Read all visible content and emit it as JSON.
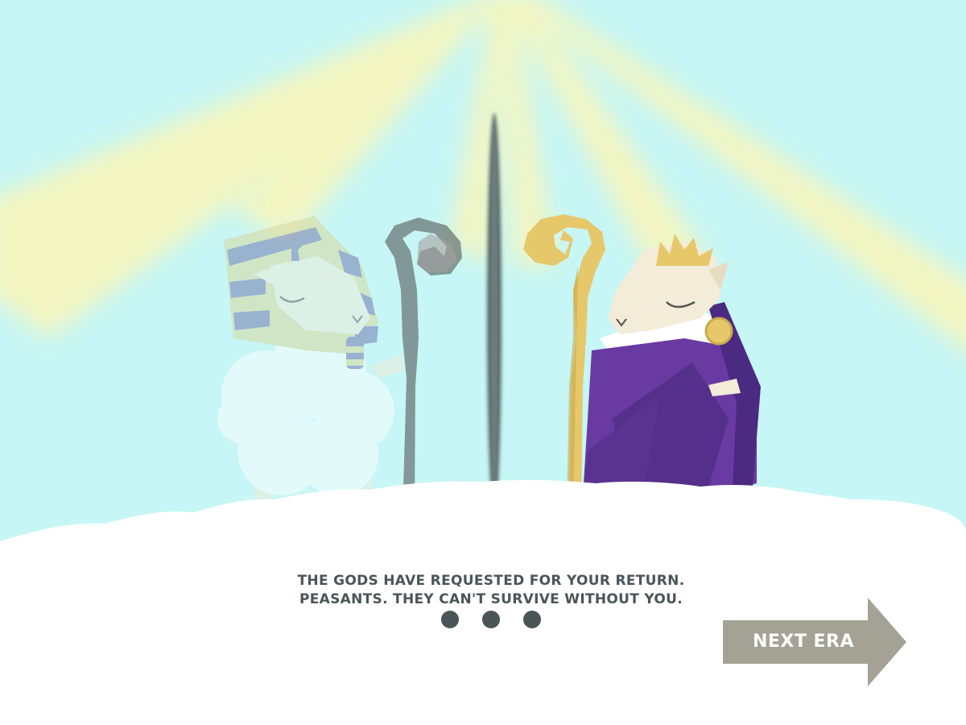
{
  "story": {
    "line1": "THE GODS HAVE REQUESTED FOR YOUR RETURN.",
    "line2": "PEASANTS. THEY CAN'T SURVIVE WITHOUT YOU."
  },
  "pagination": {
    "total": 3
  },
  "next_button": {
    "label": "NEXT ERA"
  },
  "scene": {
    "left_character": "ghost-pharaoh-sheep",
    "right_character": "royal-sheep-with-crown",
    "divider": "portal-rift",
    "icons": [
      "crook-staff-icon",
      "crown-icon",
      "cobra-uraeus-icon",
      "brooch-icon",
      "cloud-icon"
    ]
  },
  "colors": {
    "sky": "#c6f6f5",
    "light_rays": "#fbf5b8",
    "cloud": "#ffffff",
    "text": "#4a5558",
    "button": "#a4a294",
    "robe_purple": "#6a3aa3",
    "gold": "#e6c86a",
    "headdress_blue": "#6a72ad",
    "headdress_yellow": "#d8d597",
    "sheep_face": "#f3ecd8"
  }
}
